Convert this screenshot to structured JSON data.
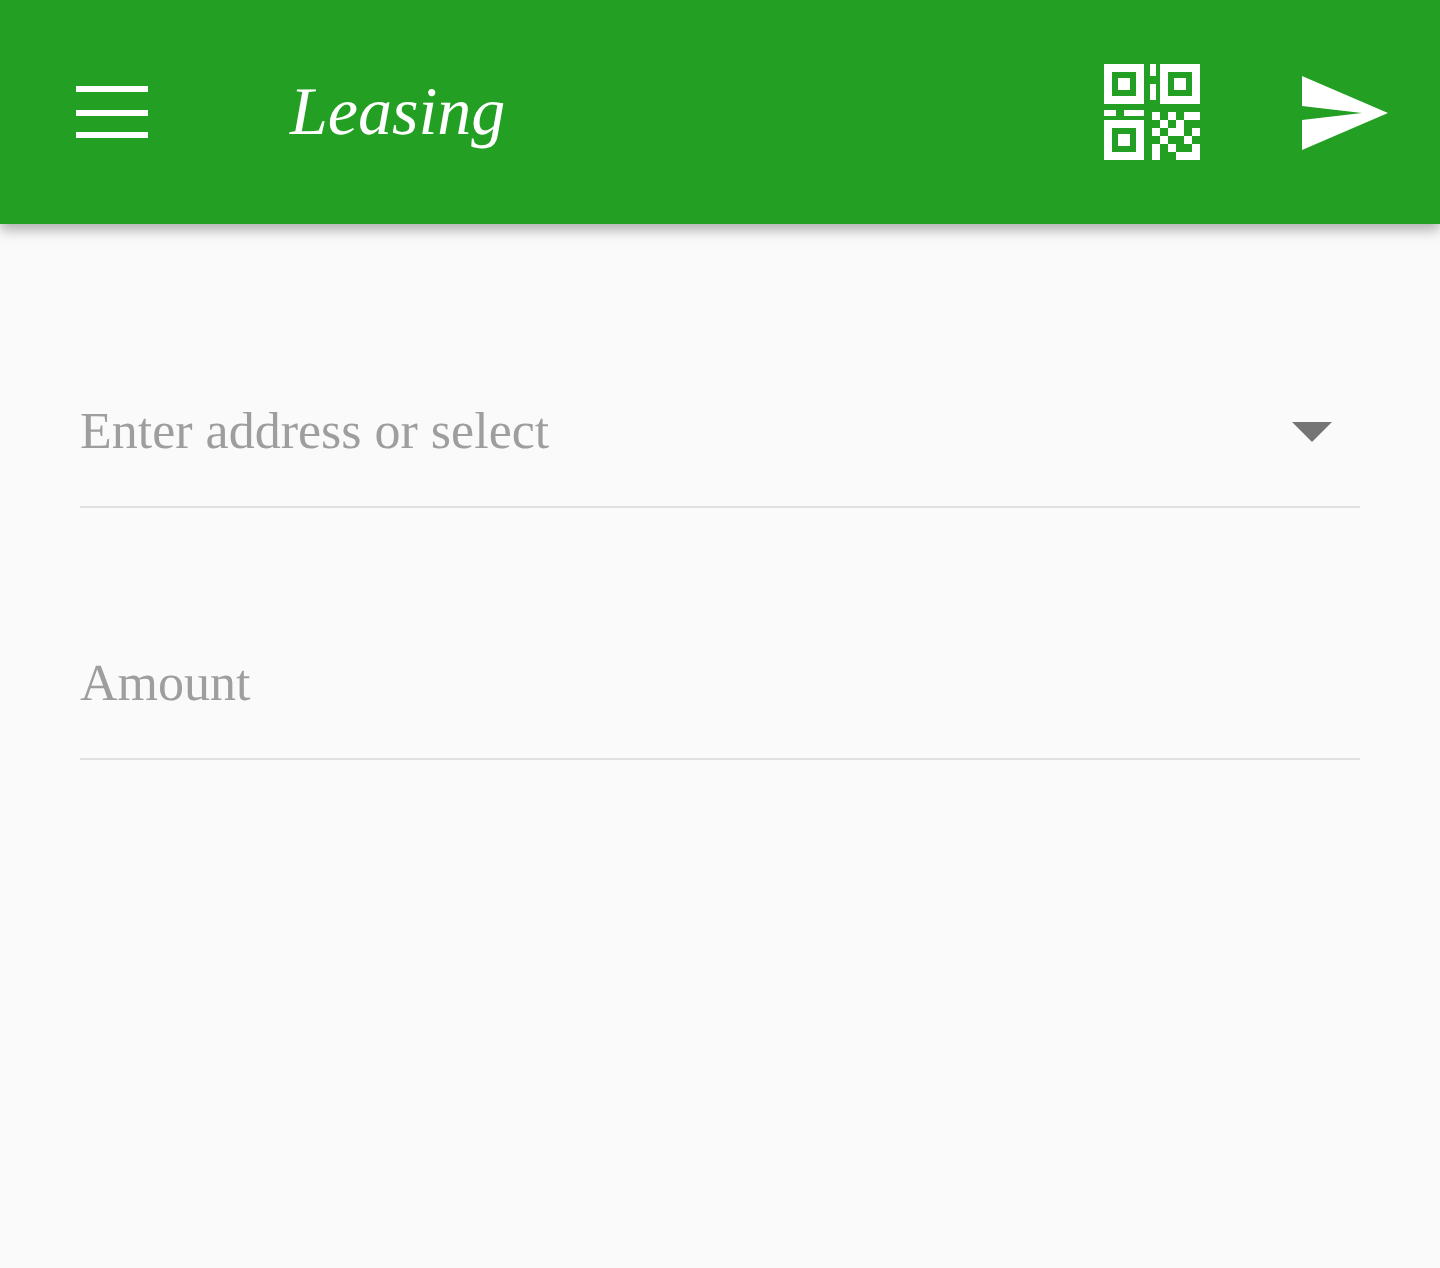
{
  "app_bar": {
    "title": "Leasing"
  },
  "fields": [
    {
      "kind": "dropdown",
      "placeholder": "Enter address or select"
    },
    {
      "kind": "text",
      "placeholder": "Amount"
    }
  ]
}
